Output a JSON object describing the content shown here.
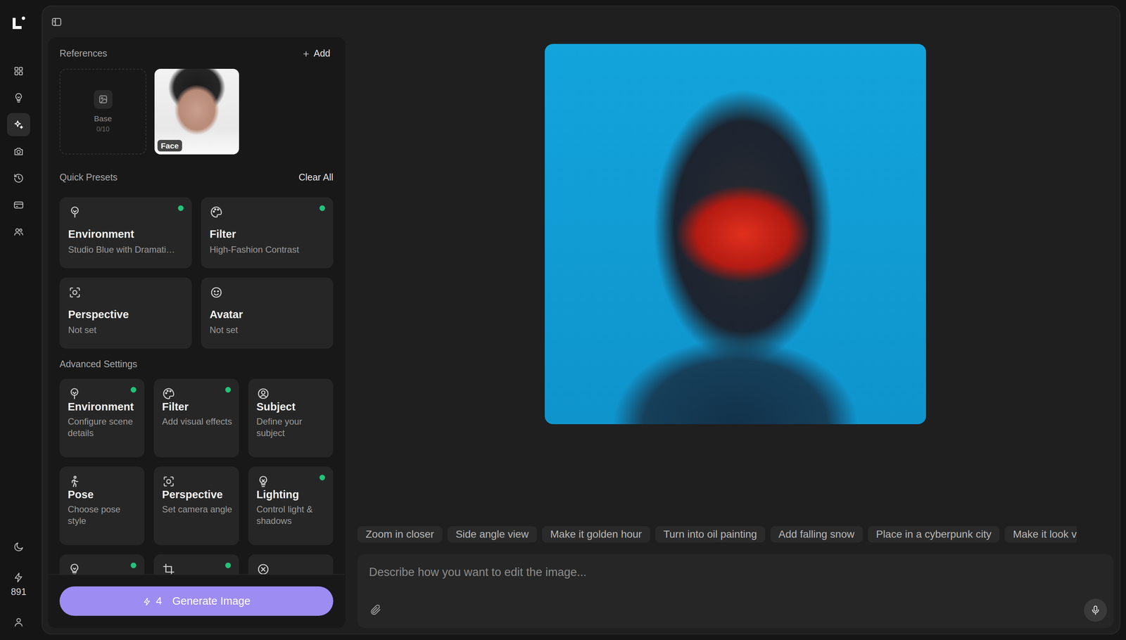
{
  "rail": {
    "items": [
      {
        "selected": false
      },
      {
        "selected": false
      },
      {
        "selected": true
      },
      {
        "selected": false
      },
      {
        "selected": false
      },
      {
        "selected": false
      },
      {
        "selected": false
      }
    ],
    "credits": "891"
  },
  "references": {
    "title": "References",
    "add": "Add",
    "slots": [
      {
        "kind": "empty",
        "label": "Base",
        "count": "0/10"
      },
      {
        "kind": "photo",
        "label": "Face"
      }
    ]
  },
  "quick_presets": {
    "title": "Quick Presets",
    "clear": "Clear All",
    "items": [
      {
        "title": "Environment",
        "value": "Studio Blue with Dramati…",
        "set": true
      },
      {
        "title": "Filter",
        "value": "High-Fashion Contrast",
        "set": true
      },
      {
        "title": "Perspective",
        "value": "Not set",
        "set": false
      },
      {
        "title": "Avatar",
        "value": "Not set",
        "set": false
      }
    ]
  },
  "advanced": {
    "title": "Advanced Settings",
    "items": [
      {
        "title": "Environment",
        "desc": "Configure scene details",
        "set": true
      },
      {
        "title": "Filter",
        "desc": "Add visual effects",
        "set": true
      },
      {
        "title": "Subject",
        "desc": "Define your subject",
        "set": false
      },
      {
        "title": "Pose",
        "desc": "Choose pose style",
        "set": false
      },
      {
        "title": "Perspective",
        "desc": "Set camera angle",
        "set": false
      },
      {
        "title": "Lighting",
        "desc": "Control light & shadows",
        "set": true
      }
    ],
    "clipped": [
      {
        "set": true
      },
      {
        "set": true
      },
      {
        "set": false
      }
    ]
  },
  "generate": {
    "cost": "4",
    "label": "Generate Image"
  },
  "suggestions": [
    "Zoom in closer",
    "Side angle view",
    "Make it golden hour",
    "Turn into oil painting",
    "Add falling snow",
    "Place in a cyberpunk city",
    "Make it look v"
  ],
  "prompt": {
    "placeholder": "Describe how you want to edit the image..."
  }
}
